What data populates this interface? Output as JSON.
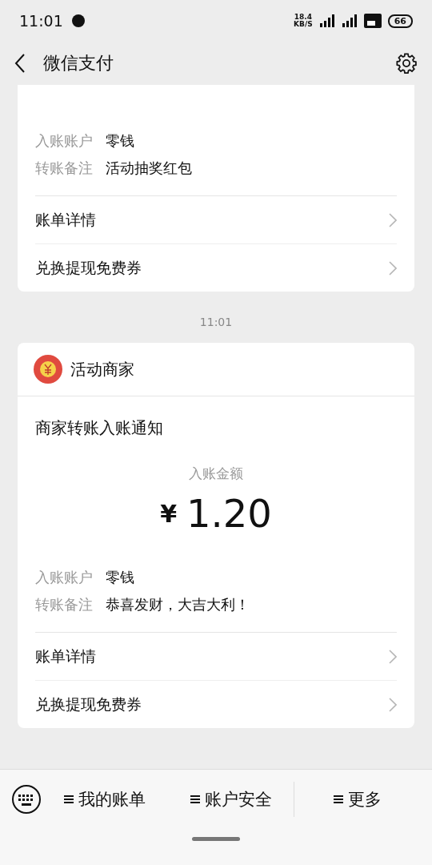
{
  "status_bar": {
    "time": "11:01",
    "speed": "18.4",
    "speed_unit": "KB/S",
    "battery": "66"
  },
  "header": {
    "title": "微信支付"
  },
  "cards": [
    {
      "fields": [
        {
          "label": "入账账户",
          "value": "零钱"
        },
        {
          "label": "转账备注",
          "value": "活动抽奖红包"
        }
      ],
      "links": [
        "账单详情",
        "兑换提现免费券"
      ]
    },
    {
      "timestamp": "11:01",
      "merchant": "活动商家",
      "title": "商家转账入账通知",
      "amount_label": "入账金额",
      "currency": "¥",
      "amount": "1.20",
      "fields": [
        {
          "label": "入账账户",
          "value": "零钱"
        },
        {
          "label": "转账备注",
          "value": "恭喜发财，大吉大利！"
        }
      ],
      "links": [
        "账单详情",
        "兑换提现免费券"
      ]
    }
  ],
  "bottom_menu": [
    "我的账单",
    "账户安全",
    "更多"
  ]
}
